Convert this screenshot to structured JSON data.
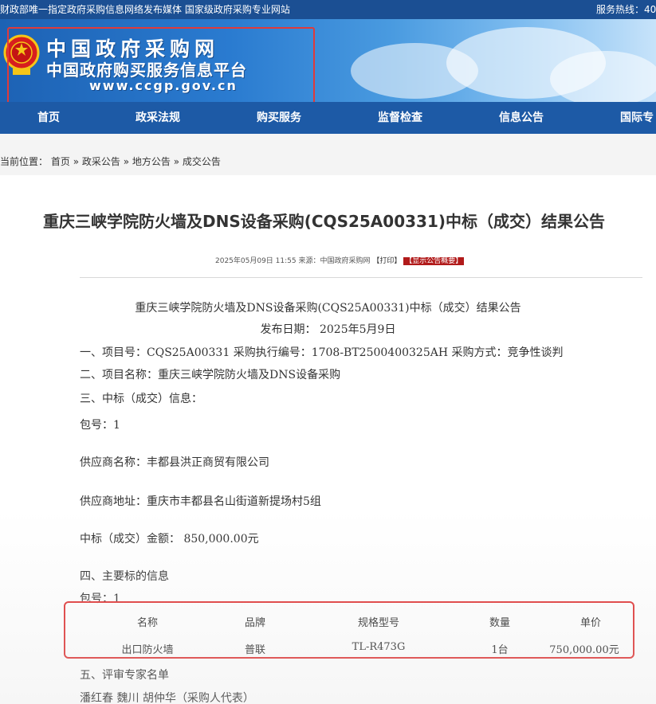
{
  "topbar": {
    "left_text": "财政部唯一指定政府采购信息网络发布媒体 国家级政府采购专业网站",
    "right_text": "服务热线：40"
  },
  "banner": {
    "site_name": "中国政府采购网",
    "site_subtitle": "中国政府购买服务信息平台",
    "site_url": "www.ccgp.gov.cn"
  },
  "nav": {
    "items": [
      {
        "label": "首页"
      },
      {
        "label": "政采法规"
      },
      {
        "label": "购买服务"
      },
      {
        "label": "监督检查"
      },
      {
        "label": "信息公告"
      },
      {
        "label": "国际专"
      }
    ]
  },
  "breadcrumb": {
    "prefix": "当前位置：",
    "items": [
      "首页",
      "政采公告",
      "地方公告",
      "成交公告"
    ],
    "separator": "»"
  },
  "article": {
    "title": "重庆三峡学院防火墙及DNS设备采购(CQS25A00331)中标（成交）结果公告",
    "meta_date": "2025年05月09日 11:55",
    "meta_source": "来源：中国政府采购网",
    "print_label": "【打印】",
    "summary_label": "【显示公告概要】",
    "heading": "重庆三峡学院防火墙及DNS设备采购(CQS25A00331)中标（成交）结果公告",
    "publish_date": "发布日期：  2025年5月9日",
    "section1": "一、项目号：CQS25A00331     采购执行编号：1708-BT2500400325AH      采购方式：竞争性谈判",
    "section2": "二、项目名称：重庆三峡学院防火墙及DNS设备采购",
    "section3": "三、中标（成交）信息：",
    "package1": "包号：1",
    "supplier_name": "供应商名称：丰都县洪正商贸有限公司",
    "supplier_address": "供应商地址：重庆市丰都县名山街道新提场村5组",
    "amount": "中标（成交）金额：  850,000.00元",
    "section4": "四、主要标的信息",
    "package2": "包号：1",
    "section5": "五、评审专家名单",
    "experts": "潘红春  魏川  胡仲华（采购人代表）"
  },
  "items_table": {
    "headers": [
      "名称",
      "品牌",
      "规格型号",
      "数量",
      "单价"
    ],
    "rows": [
      [
        "出口防火墙",
        "普联",
        "TL-R473G",
        "1台",
        "750,000.00元"
      ]
    ]
  },
  "colors": {
    "topbar": "#1b4f93",
    "nav": "#1d5aa6",
    "highlight_border": "#e03a3a",
    "summary_button": "#b11a1a"
  }
}
